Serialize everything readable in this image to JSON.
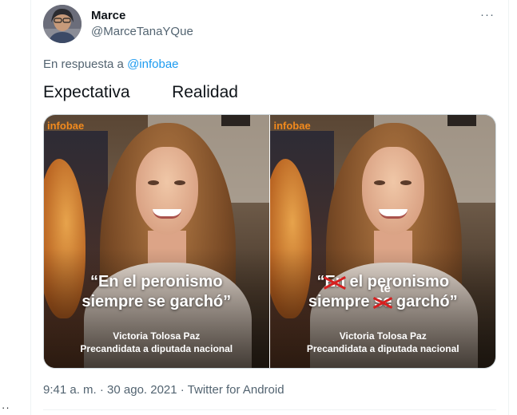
{
  "author": {
    "display_name": "Marce",
    "handle": "@MarceTanaYQue"
  },
  "more_icon": "···",
  "reply": {
    "prefix": "En respuesta a ",
    "mention": "@infobae"
  },
  "tweet_text": "Expectativa         Realidad",
  "media": [
    {
      "brand": "infobae",
      "quote_line1": "“En el peronismo",
      "quote_line2": "siempre se garchó”",
      "caption_name": "Victoria Tolosa Paz",
      "caption_role": "Precandidata a diputada nacional"
    },
    {
      "brand": "infobae",
      "quote_open": "“",
      "quote_struck1": "En",
      "quote_rest1": " el peronismo",
      "quote_pre2": "siempre ",
      "quote_struck2": "se",
      "quote_post2": " garchó”",
      "quote_insert": "te",
      "caption_name": "Victoria Tolosa Paz",
      "caption_role": "Precandidata a diputada nacional"
    }
  ],
  "meta": {
    "time": "9:41 a. m. · 30 ago. 2021 · Twitter for Android"
  },
  "side_indicator": "··"
}
